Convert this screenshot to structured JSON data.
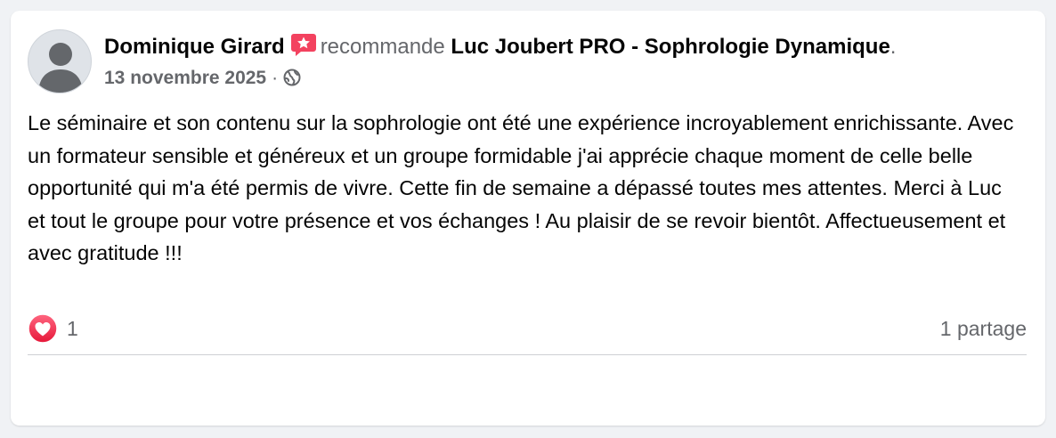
{
  "post": {
    "author": "Dominique Girard",
    "verb": "recommande",
    "page_name": "Luc Joubert PRO - Sophrologie Dynamique",
    "punctuation": ".",
    "date": "13 novembre 2025",
    "separator": "·",
    "audience_icon": "globe-icon",
    "text": "Le séminaire et son contenu sur la sophrologie ont été une expérience incroyablement enrichissante. Avec un formateur sensible et généreux et un groupe formidable j'ai apprécie chaque moment de celle belle opportunité qui m'a été permis de vivre. Cette fin de semaine a dépassé toutes mes attentes. Merci à Luc et tout le groupe pour votre présence et vos échanges ! Au plaisir de se revoir bientôt. Affectueusement et avec gratitude !!!"
  },
  "engagement": {
    "reaction_icon": "love-reaction-icon",
    "reaction_count": "1",
    "shares": "1 partage"
  },
  "colors": {
    "background": "#f0f2f5",
    "card": "#ffffff",
    "text_primary": "#050505",
    "text_secondary": "#65676b",
    "recommend_badge": "#f3425f",
    "love_reaction": "#f33e58"
  }
}
